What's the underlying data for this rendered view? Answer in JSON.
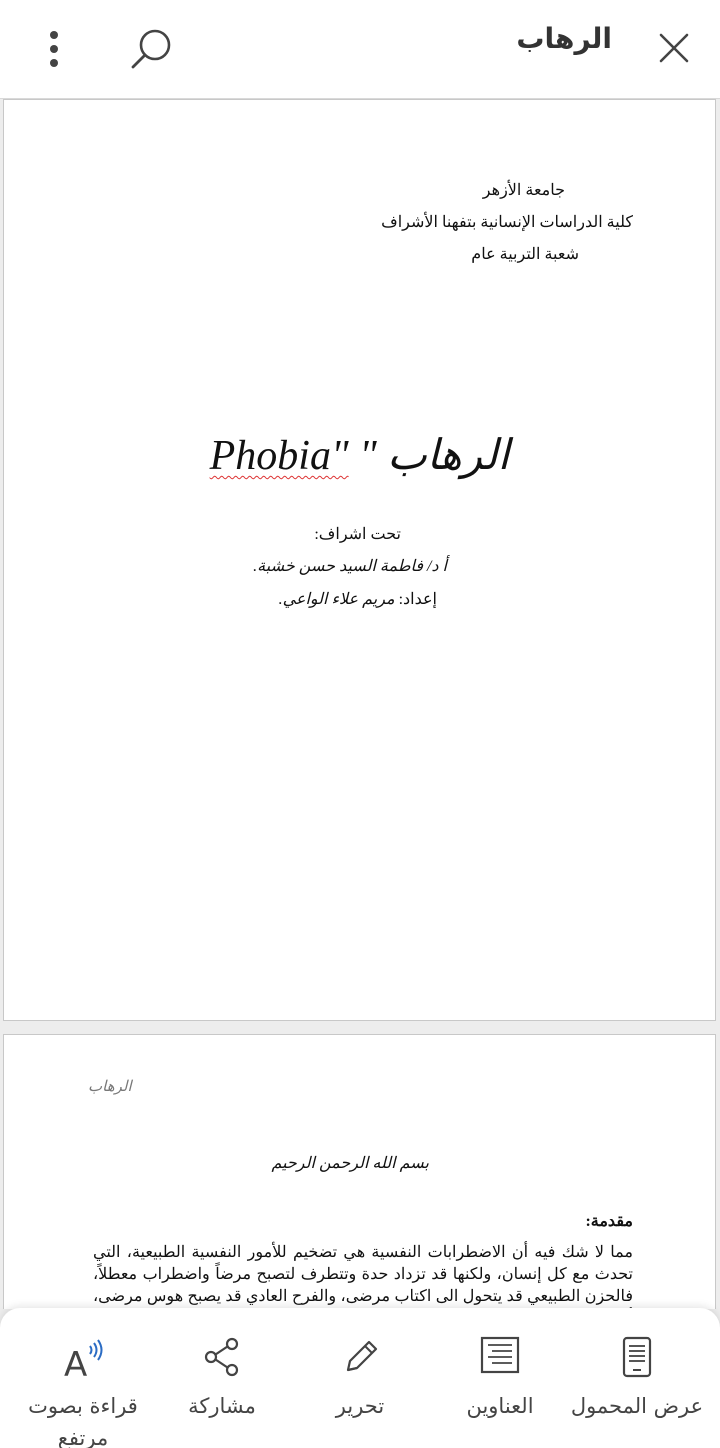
{
  "header": {
    "title": "الرهاب",
    "icons": {
      "close": "close-icon",
      "search": "search-icon",
      "more": "more-vertical-icon"
    }
  },
  "document": {
    "page1": {
      "university": "جامعة الأزهر",
      "faculty": "كلية الدراسات الإنسانية بتفهنا الأشراف",
      "department": "شعبة التربية عام",
      "title_arabic": "الرهاب \"",
      "title_latin": "Phobia\"",
      "supervision_label": "تحت اشراف:",
      "supervisor": "أ د/ فاطمة السيد حسن خشبة.",
      "prepared_by_label": "إعداد:",
      "author": "مريم علاء الواعي."
    },
    "page2": {
      "running_header": "الرهاب",
      "basmala": "بسم الله الرحمن الرحيم",
      "intro_title": "مقدمة:",
      "paragraph": "مما لا شك فيه أن الاضطرابات النفسية هي تضخيم للأمور النفسية الطبيعية، التي تحدث مع كل إنسان، ولكنها قد تزداد حدة وتتطرف لتصبح مرضاً واضطراب معطلاً، فالحزن الطبيعي قد يتحول الى اكتاب مرضى، والفرح العادي قد يصبح هوس مرضى، أما الخوف حينما"
    }
  },
  "toolbar": {
    "items": [
      {
        "label": "عرض المحمول",
        "icon": "mobile-view-icon"
      },
      {
        "label": "العناوين",
        "icon": "headings-icon"
      },
      {
        "label": "تحرير",
        "icon": "pencil-icon"
      },
      {
        "label": "مشاركة",
        "icon": "share-icon"
      },
      {
        "label": "قراءة بصوت مرتفع",
        "icon": "read-aloud-icon"
      }
    ]
  },
  "colors": {
    "text": "#333333",
    "icon": "#444444",
    "spellcheck": "#dd3333",
    "background": "#ededed"
  }
}
